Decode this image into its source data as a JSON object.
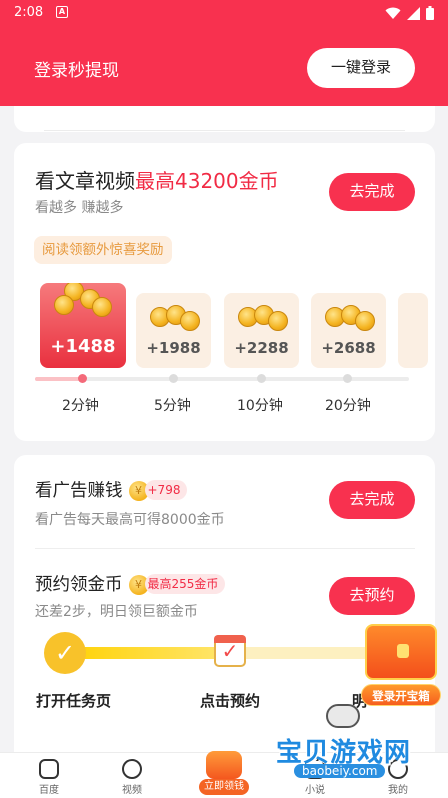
{
  "status_bar": {
    "time": "2:08",
    "notif_icon": "A"
  },
  "header": {
    "title": "登录秒提现",
    "login_button": "一键登录"
  },
  "card_read": {
    "title_plain": "看文章视频",
    "title_highlight": "最高43200金币",
    "subtitle": "看越多 赚越多",
    "action": "去完成",
    "bonus_tag": "阅读领额外惊喜奖励",
    "rewards": [
      {
        "amount": "+1488",
        "label": "2分钟"
      },
      {
        "amount": "+1988",
        "label": "5分钟"
      },
      {
        "amount": "+2288",
        "label": "10分钟"
      },
      {
        "amount": "+2688",
        "label": "20分钟"
      }
    ],
    "progress_fraction": 0.12
  },
  "card_tasks": {
    "ad": {
      "title": "看广告赚钱",
      "badge": "+798",
      "subtitle": "看广告每天最高可得8000金币",
      "action": "去完成"
    },
    "reserve": {
      "title": "预约领金币",
      "badge": "最高255金币",
      "subtitle": "还差2步，明日领巨额金币",
      "action": "去预约"
    },
    "steps": [
      {
        "label": "打开任务页"
      },
      {
        "label": "点击预约"
      },
      {
        "label": "明"
      }
    ],
    "steps_progress": 0.55
  },
  "treasure": {
    "label": "登录开宝箱"
  },
  "bottom_nav": {
    "items": [
      {
        "label": "百度"
      },
      {
        "label": "视频"
      },
      {
        "label": "立即领钱"
      },
      {
        "label": "小说"
      },
      {
        "label": "我的"
      }
    ]
  },
  "watermark": {
    "main": "宝贝游戏网",
    "sub": "baobeiy.com"
  },
  "colors": {
    "brand_red": "#f8314f",
    "gold": "#f4b31f",
    "orange": "#f46424"
  }
}
